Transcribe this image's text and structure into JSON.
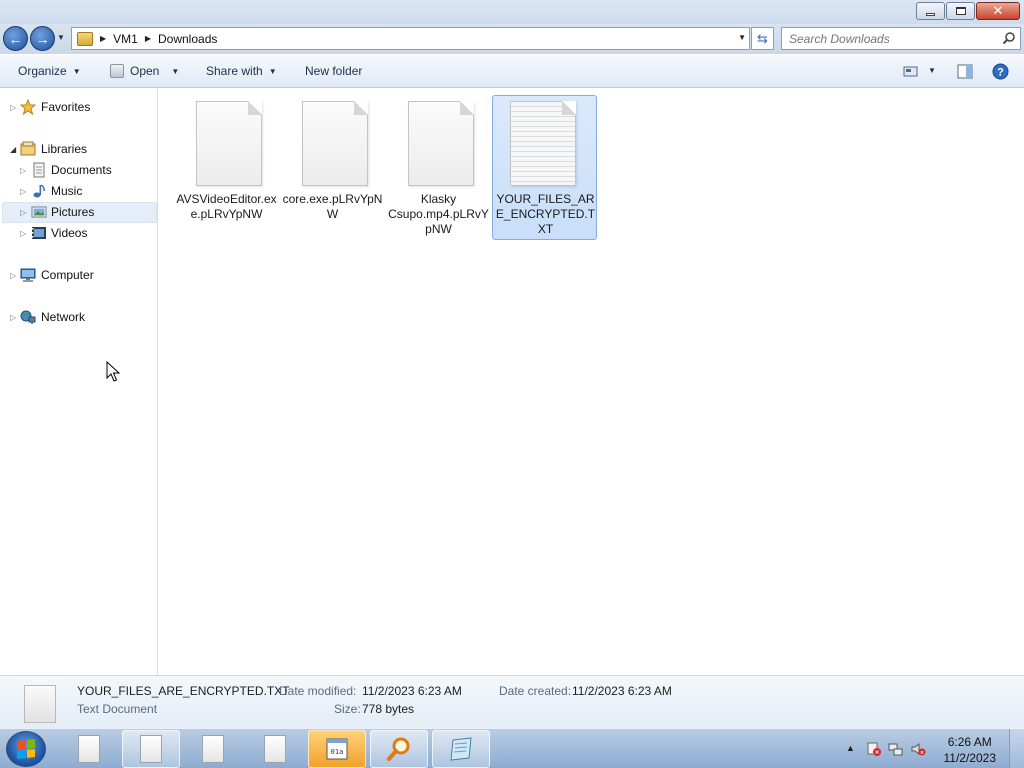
{
  "window": {
    "minimize_label": "—",
    "maximize_label": "❐",
    "close_label": "✕"
  },
  "address": {
    "breadcrumbs": [
      "VM1",
      "Downloads"
    ],
    "search_placeholder": "Search Downloads"
  },
  "toolbar": {
    "organize": "Organize",
    "open": "Open",
    "share_with": "Share with",
    "new_folder": "New folder"
  },
  "nav": {
    "favorites": "Favorites",
    "libraries": "Libraries",
    "documents": "Documents",
    "music": "Music",
    "pictures": "Pictures",
    "videos": "Videos",
    "computer": "Computer",
    "network": "Network"
  },
  "files": [
    {
      "name": "AVSVideoEditor.exe.pLRvYpNW",
      "selected": false
    },
    {
      "name": "core.exe.pLRvYpNW",
      "selected": false
    },
    {
      "name": "Klasky Csupo.mp4.pLRvYpNW",
      "selected": false
    },
    {
      "name": "YOUR_FILES_ARE_ENCRYPTED.TXT",
      "selected": true
    }
  ],
  "details": {
    "filename": "YOUR_FILES_ARE_ENCRYPTED.TXT",
    "type": "Text Document",
    "date_modified_label": "Date modified:",
    "date_modified": "11/2/2023 6:23 AM",
    "date_created_label": "Date created:",
    "date_created": "11/2/2023 6:23 AM",
    "size_label": "Size:",
    "size": "778 bytes"
  },
  "taskbar": {
    "time": "6:26 AM",
    "date": "11/2/2023"
  },
  "colors": {
    "selection": "#cce0fa",
    "accent": "#1f4f9a"
  }
}
